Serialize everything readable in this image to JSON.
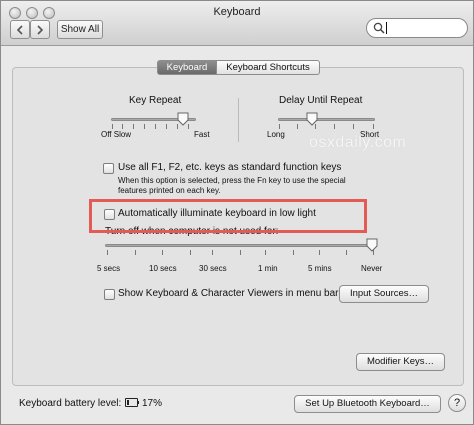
{
  "window": {
    "title": "Keyboard"
  },
  "toolbar": {
    "show_all_label": "Show All",
    "search_value": ""
  },
  "tabs": [
    {
      "label": "Keyboard",
      "selected": true
    },
    {
      "label": "Keyboard Shortcuts",
      "selected": false
    }
  ],
  "key_repeat": {
    "heading": "Key Repeat",
    "left_labels": "Off  Slow",
    "right_label": "Fast",
    "level": 0.85
  },
  "delay_until_repeat": {
    "heading": "Delay Until Repeat",
    "left_label": "Long",
    "right_label": "Short",
    "level": 0.35
  },
  "watermark": "osxdaily.com",
  "fn_keys": {
    "label": "Use all F1, F2, etc. keys as standard function keys",
    "note_line1": "When this option is selected, press the Fn key to use the special",
    "note_line2": "features printed on each key.",
    "checked": false
  },
  "illuminate": {
    "label": "Automatically illuminate keyboard in low light",
    "checked": false
  },
  "turn_off": {
    "label": "Turn off when computer is not used for:",
    "ticks": [
      "5 secs",
      "10 secs",
      "30 secs",
      "1 min",
      "5 mins",
      "Never"
    ],
    "selected": "Never"
  },
  "viewers": {
    "label": "Show Keyboard & Character Viewers in menu bar",
    "checked": false
  },
  "buttons": {
    "input_sources": "Input Sources…",
    "modifier_keys": "Modifier Keys…",
    "bluetooth": "Set Up Bluetooth Keyboard…",
    "help": "?"
  },
  "battery": {
    "label": "Keyboard battery level:",
    "percent_text": "17%",
    "level": 0.17
  },
  "colors": {
    "highlight": "#e45a55",
    "selected_tab": "#7a7a7a"
  }
}
